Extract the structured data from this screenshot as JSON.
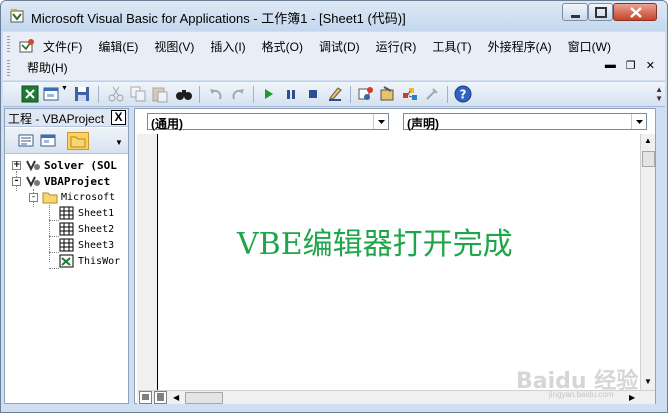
{
  "window": {
    "title": "Microsoft Visual Basic for Applications - 工作簿1 - [Sheet1 (代码)]"
  },
  "menu": {
    "items": [
      "文件(F)",
      "编辑(E)",
      "视图(V)",
      "插入(I)",
      "格式(O)",
      "调试(D)",
      "运行(R)",
      "工具(T)",
      "外接程序(A)",
      "窗口(W)"
    ],
    "help": "帮助(H)"
  },
  "project": {
    "title": "工程 - VBAProject",
    "close_glyph": "X",
    "tree": [
      {
        "label": "Solver (SOL",
        "level": 0,
        "expander": "+",
        "icon": "vba-project-icon",
        "bold": true
      },
      {
        "label": "VBAProject",
        "level": 0,
        "expander": "-",
        "icon": "vba-project-icon",
        "bold": true
      },
      {
        "label": "Microsoft",
        "level": 1,
        "expander": "-",
        "icon": "folder-icon",
        "bold": false
      },
      {
        "label": "Sheet1",
        "level": 2,
        "expander": "",
        "icon": "sheet-icon",
        "bold": false
      },
      {
        "label": "Sheet2",
        "level": 2,
        "expander": "",
        "icon": "sheet-icon",
        "bold": false
      },
      {
        "label": "Sheet3",
        "level": 2,
        "expander": "",
        "icon": "sheet-icon",
        "bold": false
      },
      {
        "label": "ThisWor",
        "level": 2,
        "expander": "",
        "icon": "workbook-icon",
        "bold": false
      }
    ]
  },
  "code_window": {
    "object_combo": "(通用)",
    "procedure_combo": "(声明)",
    "content": "VBE编辑器打开完成"
  },
  "watermark": {
    "text": "Baidu 经验",
    "sub": "jingyan.baidu.com"
  },
  "colors": {
    "code_text": "#1fa64a",
    "titlebar": "#c4d7ee",
    "close_button": "#c7432a"
  }
}
